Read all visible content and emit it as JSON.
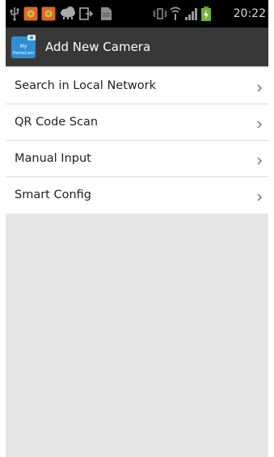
{
  "status_bar": {
    "time": "20:22",
    "icons": [
      "usb-icon",
      "app-notification-icon",
      "app-notification-icon",
      "cloud-icon",
      "transfer-icon",
      "file-icon",
      "vibrate-icon",
      "wifi-icon",
      "signal-icon",
      "battery-charging-icon"
    ]
  },
  "action_bar": {
    "title": "Add New Camera",
    "app_icon": "my-homecam-app-icon",
    "app_icon_text_1": "My",
    "app_icon_text_2": "HomeCam"
  },
  "menu": {
    "items": [
      {
        "label": "Search in Local Network",
        "icon": "chevron-right-icon"
      },
      {
        "label": "QR Code Scan",
        "icon": "chevron-right-icon"
      },
      {
        "label": "Manual Input",
        "icon": "chevron-right-icon"
      },
      {
        "label": "Smart Config",
        "icon": "chevron-right-icon"
      }
    ]
  },
  "colors": {
    "status_bar": "#000000",
    "action_bar": "#383838",
    "list_background": "#ffffff",
    "screen_background": "#e6e6e6",
    "divider": "#dcdcdc"
  }
}
